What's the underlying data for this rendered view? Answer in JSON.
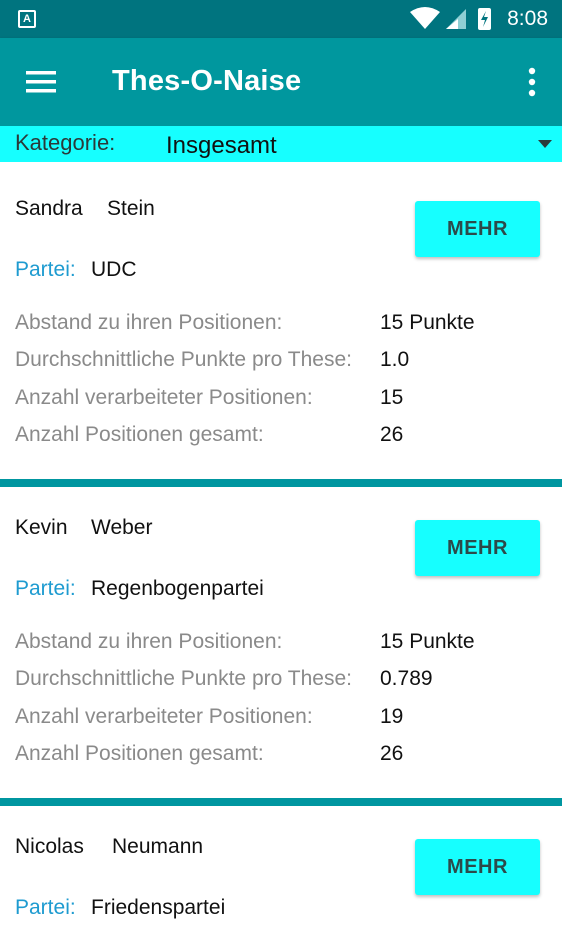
{
  "status_bar": {
    "time": "8:08",
    "app_badge": "A"
  },
  "app_bar": {
    "title": "Thes-O-Naise"
  },
  "category": {
    "label": "Kategorie:",
    "value": "Insgesamt"
  },
  "colors": {
    "status_bar": "#00747f",
    "app_bar": "#00979e",
    "accent_cyan": "#16ffff",
    "party_label": "#1e9bd0",
    "divider": "#0096a0"
  },
  "labels": {
    "more_button": "MEHR",
    "party": "Partei:",
    "distance": "Abstand zu ihren Positionen:",
    "avg_points": "Durchschnittliche Punkte pro These:",
    "processed": "Anzahl verarbeiteter Positionen:",
    "total": "Anzahl Positionen gesamt:"
  },
  "candidates": [
    {
      "first_name": "Sandra",
      "last_name": "Stein",
      "party": "UDC",
      "distance": "15 Punkte",
      "avg_points": "1.0",
      "processed": "15",
      "total": "26"
    },
    {
      "first_name": "Kevin",
      "last_name": "Weber",
      "party": "Regenbogenpartei",
      "distance": "15 Punkte",
      "avg_points": "0.789",
      "processed": "19",
      "total": "26"
    },
    {
      "first_name": "Nicolas",
      "last_name": "Neumann",
      "party": "Friedenspartei"
    }
  ]
}
